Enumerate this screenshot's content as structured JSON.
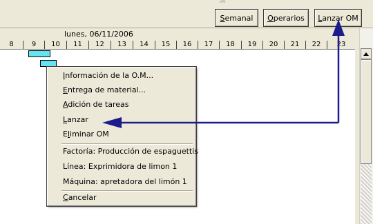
{
  "toolbar": {
    "buttons": [
      {
        "mnemonic": "S",
        "rest": "emanal"
      },
      {
        "mnemonic": "O",
        "rest": "perarios"
      },
      {
        "mnemonic": "L",
        "rest": "anzar OM"
      }
    ]
  },
  "calendar": {
    "date_label": "lunes, 06/11/2006",
    "hours": [
      "8",
      "9",
      "10",
      "11",
      "12",
      "13",
      "14",
      "15",
      "16",
      "17",
      "18",
      "19",
      "20",
      "21",
      "22",
      "23"
    ]
  },
  "context_menu": {
    "items": [
      {
        "mnemonic": "I",
        "rest": "nformación de la O.M..."
      },
      {
        "mnemonic": "E",
        "rest": "ntrega de material..."
      },
      {
        "mnemonic": "A",
        "rest": "dición de tareas"
      },
      {
        "mnemonic": "L",
        "rest": "anzar"
      },
      {
        "prefix": "E",
        "mnemonic": "l",
        "rest": "iminar OM"
      },
      {
        "text": "Factoría: Producción de espaguettis"
      },
      {
        "text": "Línea: Exprimidora de limon 1"
      },
      {
        "text": "Máquina: apretadora del limón 1"
      },
      {
        "mnemonic": "C",
        "rest": "ancelar"
      }
    ]
  },
  "colors": {
    "task_bar": "#66e3f0",
    "annotation_arrow": "#1b1b8a",
    "window_face": "#ece9d8"
  }
}
